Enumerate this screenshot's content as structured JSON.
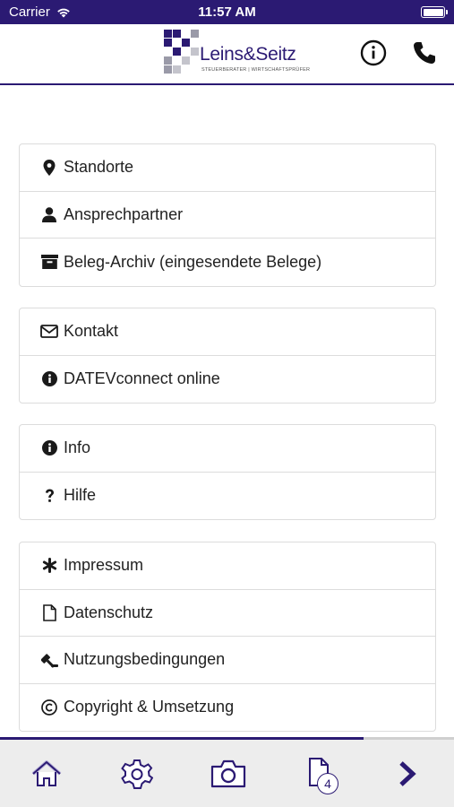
{
  "status_bar": {
    "carrier": "Carrier",
    "time": "11:57 AM"
  },
  "header": {
    "logo": {
      "name": "Leins&Seitz",
      "subtitle": "STEUERBERATER | WIRTSCHAFTSPRÜFER"
    },
    "info_icon": "info-circle-icon",
    "phone_icon": "phone-icon"
  },
  "menu": {
    "groups": [
      {
        "items": [
          {
            "label": "Standorte",
            "icon": "map-marker-icon"
          },
          {
            "label": "Ansprechpartner",
            "icon": "user-icon"
          },
          {
            "label": "Beleg-Archiv (eingesendete Belege)",
            "icon": "archive-icon"
          }
        ]
      },
      {
        "items": [
          {
            "label": "Kontakt",
            "icon": "envelope-icon"
          },
          {
            "label": "DATEVconnect online",
            "icon": "info-circle-icon"
          }
        ]
      },
      {
        "items": [
          {
            "label": "Info",
            "icon": "info-circle-icon"
          },
          {
            "label": "Hilfe",
            "icon": "question-icon"
          }
        ]
      },
      {
        "items": [
          {
            "label": "Impressum",
            "icon": "asterisk-icon"
          },
          {
            "label": "Datenschutz",
            "icon": "file-icon"
          },
          {
            "label": "Nutzungsbedingungen",
            "icon": "gavel-icon"
          },
          {
            "label": "Copyright & Umsetzung",
            "icon": "copyright-icon"
          }
        ]
      }
    ]
  },
  "tab_bar": {
    "progress": 0.8,
    "tabs": [
      {
        "icon": "home-icon"
      },
      {
        "icon": "gear-icon"
      },
      {
        "icon": "camera-icon"
      },
      {
        "icon": "documents-icon",
        "badge": "4"
      },
      {
        "icon": "chevron-right-icon"
      }
    ]
  },
  "colors": {
    "brand": "#2b1a73",
    "border": "#dcdcdc",
    "tabbar_bg": "#ededed"
  }
}
